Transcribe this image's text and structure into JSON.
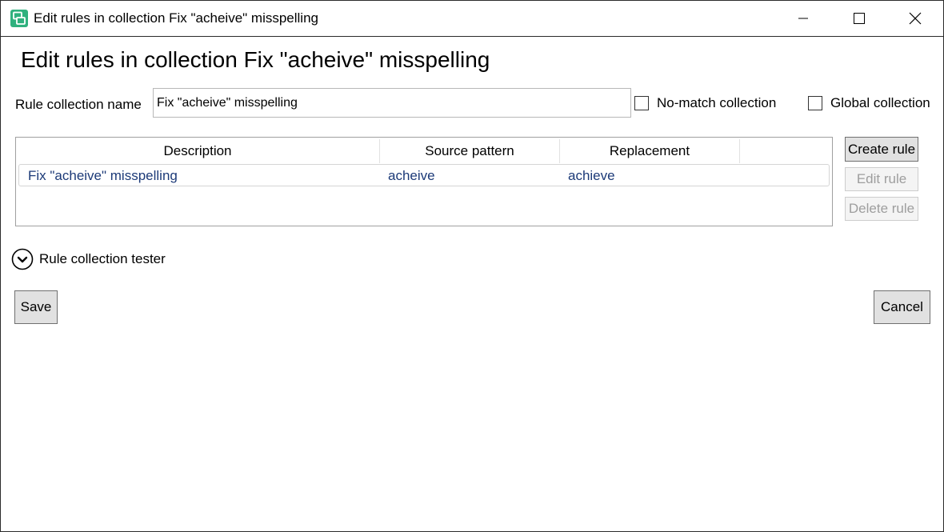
{
  "window": {
    "title": "Edit rules in collection Fix \"acheive\" misspelling",
    "icon": "app-logo-icon",
    "accent": "#2fb17e"
  },
  "page": {
    "heading": "Edit rules in collection Fix \"acheive\" misspelling",
    "collection_name_label": "Rule collection name",
    "collection_name_value": "Fix \"acheive\" misspelling",
    "no_match_label": "No-match collection",
    "no_match_checked": false,
    "global_label": "Global collection",
    "global_checked": false
  },
  "rules_table": {
    "columns": [
      "Description",
      "Source pattern",
      "Replacement"
    ],
    "rows": [
      {
        "description": "Fix \"acheive\" misspelling",
        "source": "acheive",
        "replacement": "achieve"
      }
    ]
  },
  "side_buttons": {
    "create": "Create rule",
    "edit": "Edit rule",
    "delete": "Delete rule"
  },
  "tester": {
    "label": "Rule collection tester",
    "expanded": false
  },
  "footer": {
    "save": "Save",
    "cancel": "Cancel"
  }
}
